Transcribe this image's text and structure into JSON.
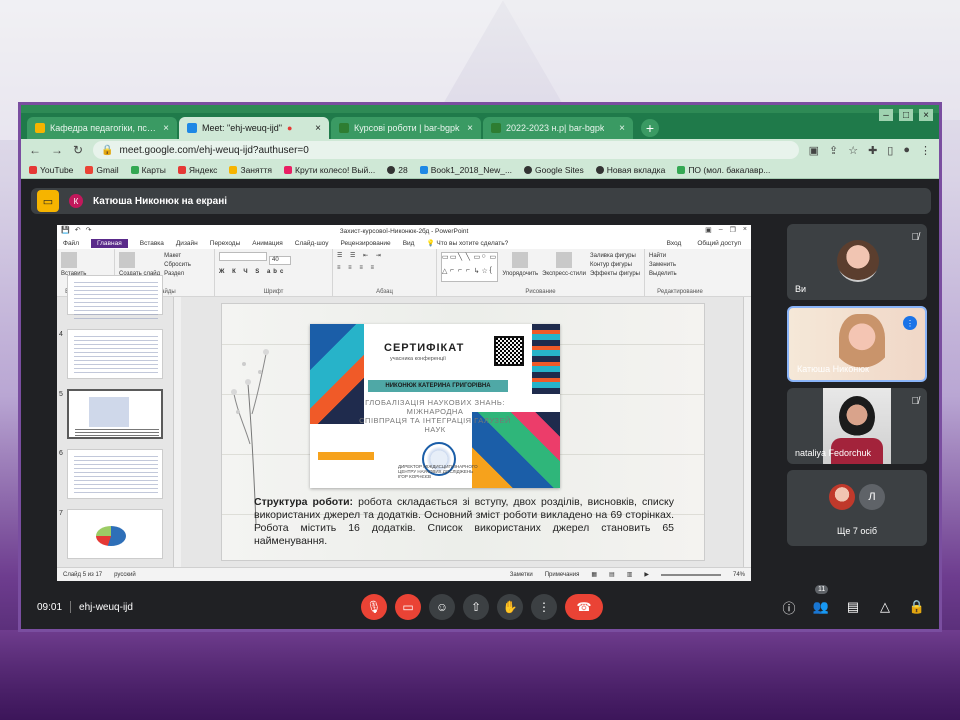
{
  "browser": {
    "tabs": [
      {
        "label": "Кафедра педагогіки, психології",
        "color": "#f6b400",
        "active": false
      },
      {
        "label": "Meet: \"ehj-weuq-ijd\"",
        "color": "#1e88e5",
        "active": true
      },
      {
        "label": "Курсові роботи | bar-bgpk",
        "color": "#2e7d32",
        "active": false
      },
      {
        "label": "2022-2023 н.р| bar-bgpk",
        "color": "#2e7d32",
        "active": false
      }
    ],
    "url": "meet.google.com/ehj-weuq-ijd?authuser=0",
    "bookmarks": [
      {
        "label": "YouTube",
        "color": "#e53935"
      },
      {
        "label": "Gmail",
        "color": "#ea4335"
      },
      {
        "label": "Карты",
        "color": "#34a853"
      },
      {
        "label": "Яндекс",
        "color": "#e53935"
      },
      {
        "label": "Заняття",
        "color": "#f6b400"
      },
      {
        "label": "Крути колесо! Вый...",
        "color": "#e91e63"
      },
      {
        "label": "28",
        "color": "#333333"
      },
      {
        "label": "Book1_2018_New_...",
        "color": "#1e88e5"
      },
      {
        "label": "Google Sites",
        "color": "#333333"
      },
      {
        "label": "Новая вкладка",
        "color": "#333333"
      },
      {
        "label": "ПО (мол. бакалавр...",
        "color": "#34a853"
      }
    ]
  },
  "meet": {
    "presenting_label": "Катюша Никонюк на екрані",
    "presenter_initial": "К",
    "time": "09:01",
    "meeting_code": "ehj-weuq-ijd",
    "participants_count": "11",
    "tiles": [
      {
        "name": "Ви"
      },
      {
        "name": "Катюша Никонюк"
      },
      {
        "name": "nataliya Fedorchuk"
      }
    ],
    "more_label": "Ще 7 осіб",
    "more_initial": "Л"
  },
  "ppt": {
    "title": "Захист-курсової-Никонюк-2бд - PowerPoint",
    "menu": [
      "Файл",
      "Главная",
      "Вставка",
      "Дизайн",
      "Переходы",
      "Анимация",
      "Слайд-шоу",
      "Рецензирование",
      "Вид",
      "Что вы хотите сделать?"
    ],
    "menu_right": [
      "Вход",
      "Общий доступ"
    ],
    "ribbon": {
      "paste": "Вставить",
      "clipboard": "Буфер обмена",
      "create_slide": "Создать слайд",
      "layout": "Макет",
      "reset": "Сбросить",
      "section": "Раздел",
      "slides": "Слайды",
      "font_size": "40",
      "font": "Шрифт",
      "paragraph": "Абзац",
      "arrange": "Упорядочить",
      "styles": "Экспресс-стили",
      "fill": "Заливка фигуры",
      "outline": "Контур фигуры",
      "effects": "Эффекты фигуры",
      "drawing": "Рисование",
      "find": "Найти",
      "replace": "Заменить",
      "select": "Выделить",
      "editing": "Редактирование"
    },
    "thumb_numbers": [
      "4",
      "5",
      "6",
      "7"
    ],
    "status": {
      "slide": "Слайд 5 из 17",
      "lang": "русский",
      "notes": "Заметки",
      "comments": "Примечания",
      "zoom": "74%"
    },
    "certificate": {
      "title": "СЕРТИФІКАТ",
      "subtitle": "учасника конференції",
      "name": "НИКОНЮК КАТЕРИНА ГРИГОРІВНА",
      "topic_line1": "ГЛОБАЛІЗАЦІЯ НАУКОВИХ ЗНАНЬ: МІЖНАРОДНА",
      "topic_line2": "СПІВПРАЦЯ ТА ІНТЕГРАЦІЯ ГАЛУЗЕЙ НАУК",
      "sign_line1": "ДИРЕКТОР МІЖДИСЦИПЛІНАРНОГО",
      "sign_line2": "ЦЕНТРУ НАУКОВИХ ДОСЛІДЖЕНЬ",
      "sign_line3": "ІГОР КОРНЄЄВ"
    },
    "slide_text": {
      "bold": "Структура роботи:",
      "rest": " робота складається зі вступу, двох розділів, висновків, списку використаних джерел та додатків. Основний зміст роботи викладено на 69 сторінках. Робота містить 16 додатків. Список використаних джерел становить 65 найменування."
    }
  }
}
